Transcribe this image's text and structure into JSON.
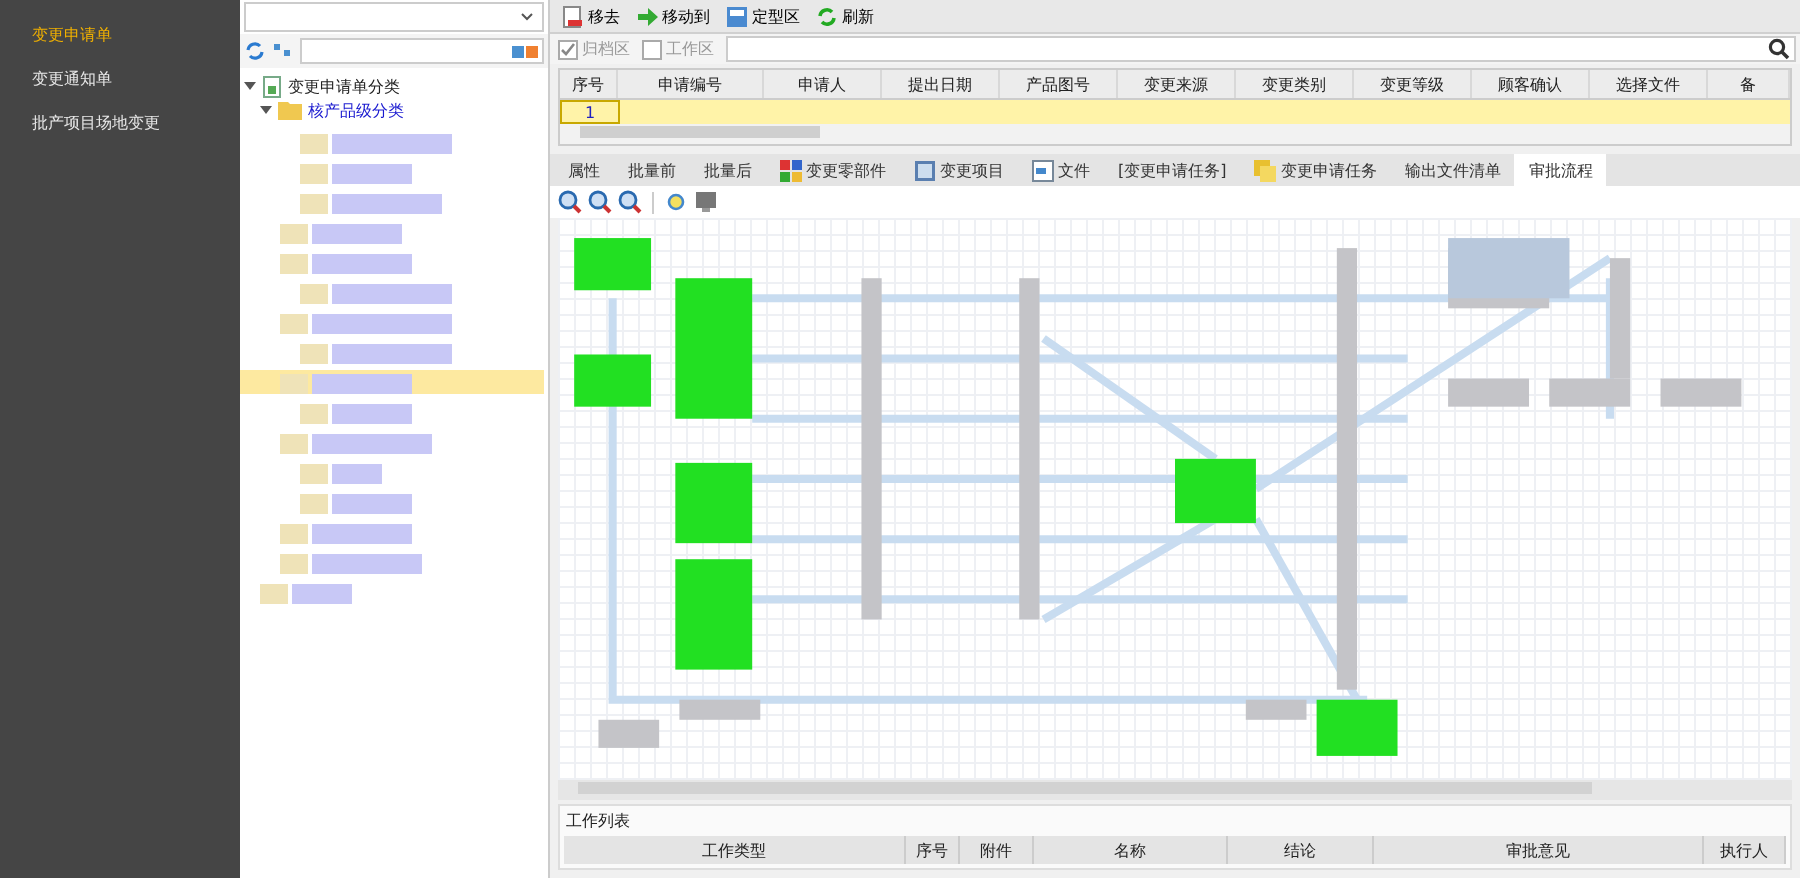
{
  "sidebar": {
    "items": [
      {
        "label": "变更申请单",
        "selected": true
      },
      {
        "label": "变更通知单",
        "selected": false
      },
      {
        "label": "批产项目场地变更",
        "selected": false
      }
    ]
  },
  "toolbar": {
    "buttons": [
      {
        "label": "移去",
        "kind": "remove"
      },
      {
        "label": "移动到",
        "kind": "move"
      },
      {
        "label": "定型区",
        "kind": "save"
      },
      {
        "label": "刷新",
        "kind": "refresh"
      }
    ]
  },
  "filters": [
    {
      "label": "归档区",
      "checked": true
    },
    {
      "label": "工作区",
      "checked": false
    }
  ],
  "tree": {
    "label": "变更申请单分类",
    "expanded": true,
    "children": [
      {
        "label": "核产品级分类",
        "expanded": true
      }
    ]
  },
  "table": {
    "columns": [
      "序号",
      "申请编号",
      "申请人",
      "提出日期",
      "产品图号",
      "变更来源",
      "变更类别",
      "变更等级",
      "顾客确认",
      "选择文件",
      "备"
    ],
    "rows": [
      {
        "cells": [
          "1"
        ],
        "selected": true
      }
    ]
  },
  "tabs": [
    {
      "label": "属性",
      "selected": false,
      "kind": "plain"
    },
    {
      "label": "批量前",
      "selected": false,
      "kind": "plain"
    },
    {
      "label": "批量后",
      "selected": false,
      "kind": "plain"
    },
    {
      "label": "变更零部件",
      "selected": false,
      "kind": "parts"
    },
    {
      "label": "变更项目",
      "selected": false,
      "kind": "project"
    },
    {
      "label": "文件",
      "selected": false,
      "kind": "file"
    },
    {
      "label": "[变更申请任务]",
      "selected": false,
      "kind": "plain"
    },
    {
      "label": "变更申请任务",
      "selected": false,
      "kind": "task"
    },
    {
      "label": "输出文件清单",
      "selected": false,
      "kind": "plain"
    },
    {
      "label": "审批流程",
      "selected": true,
      "kind": "plain"
    }
  ],
  "worklist": {
    "title": "工作列表",
    "columns": [
      "工作类型",
      "序号",
      "附件",
      "名称",
      "结论",
      "审批意见",
      "执行人"
    ]
  }
}
